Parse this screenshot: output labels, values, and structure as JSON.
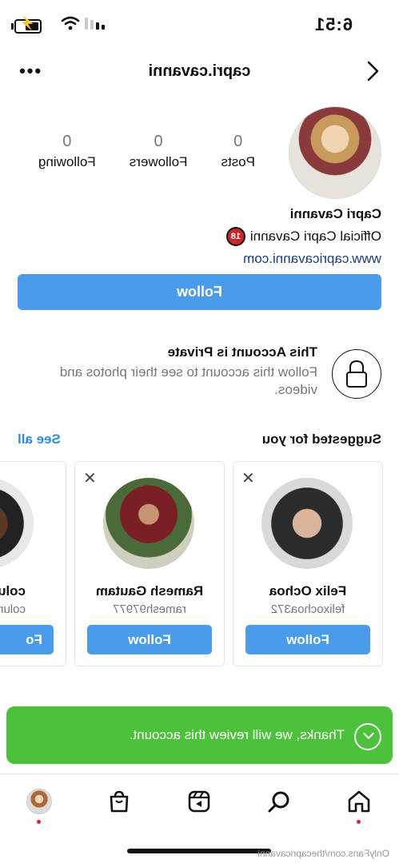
{
  "status_bar": {
    "time": "6:51"
  },
  "header": {
    "username": "capri.cavanni",
    "back_icon": "chevron-left-icon",
    "more_icon": "ellipsis-icon"
  },
  "profile": {
    "stats": [
      {
        "value": "0",
        "label": "Posts"
      },
      {
        "value": "0",
        "label": "Followers"
      },
      {
        "value": "0",
        "label": "Following"
      }
    ],
    "display_name": "Capri Cavanni",
    "bio_line": "Official Capri Cavanni",
    "bio_badge": "18",
    "website": "www.capricavanni.com",
    "follow_label": "Follow"
  },
  "private_notice": {
    "title": "This Account is Private",
    "text": "Follow this account to see their photos and videos."
  },
  "suggestions": {
    "title": "Suggested for you",
    "see_all": "See all",
    "cards": [
      {
        "name": "Felix Ochoa",
        "handle": "felixochoa372",
        "button": "Follow"
      },
      {
        "name": "Ramesh Gautam",
        "handle": "ramesh97977",
        "button": "Follow"
      },
      {
        "name": "colun",
        "handle": "colun",
        "button": "Fo"
      }
    ]
  },
  "toast": {
    "message": "Thanks, we will review this account."
  },
  "tab_bar": [
    "home-icon",
    "search-icon",
    "reels-icon",
    "shop-icon",
    "profile-avatar"
  ],
  "watermark": "OnlyFans.com/thecapricavanni",
  "colors": {
    "accent": "#4a9bea",
    "toast": "#4cc23c",
    "link": "#1a3f7a",
    "see_all": "#2f8be0"
  }
}
